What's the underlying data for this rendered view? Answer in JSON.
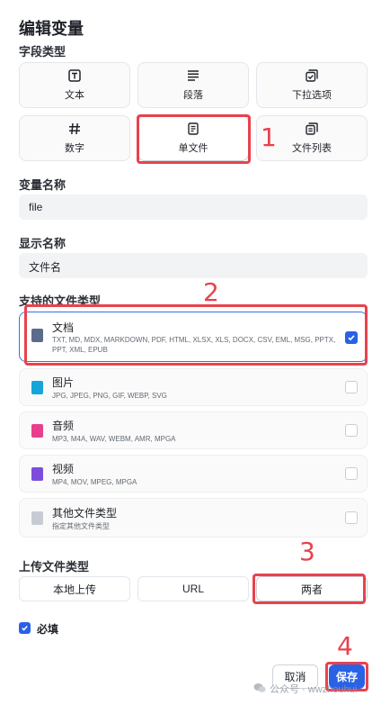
{
  "dialog": {
    "title": "编辑变量",
    "field_type_label": "字段类型",
    "field_types": [
      {
        "label": "文本",
        "icon": "text-icon"
      },
      {
        "label": "段落",
        "icon": "paragraph-icon"
      },
      {
        "label": "下拉选项",
        "icon": "select-icon"
      },
      {
        "label": "数字",
        "icon": "number-icon"
      },
      {
        "label": "单文件",
        "icon": "single-file-icon",
        "selected": true
      },
      {
        "label": "文件列表",
        "icon": "file-list-icon"
      }
    ],
    "variable_name_label": "变量名称",
    "variable_name_value": "file",
    "display_name_label": "显示名称",
    "display_name_value": "文件名",
    "supported_types_label": "支持的文件类型",
    "file_types": [
      {
        "title": "文档",
        "desc": "TXT, MD, MDX, MARKDOWN, PDF, HTML, XLSX, XLS, DOCX, CSV, EML, MSG, PPTX, PPT, XML, EPUB",
        "checked": true,
        "color": "#5b6b8c"
      },
      {
        "title": "图片",
        "desc": "JPG, JPEG, PNG, GIF, WEBP, SVG",
        "checked": false,
        "color": "#16a5d8"
      },
      {
        "title": "音频",
        "desc": "MP3, M4A, WAV, WEBM, AMR, MPGA",
        "checked": false,
        "color": "#e83e8c"
      },
      {
        "title": "视频",
        "desc": "MP4, MOV, MPEG, MPGA",
        "checked": false,
        "color": "#7c4ddc"
      },
      {
        "title": "其他文件类型",
        "desc": "指定其他文件类型",
        "checked": false,
        "color": "#c7cbd4"
      }
    ],
    "upload_type_label": "上传文件类型",
    "upload_types": [
      "本地上传",
      "URL",
      "两者"
    ],
    "required_label": "必填",
    "cancel_label": "取消",
    "save_label": "保存"
  },
  "annotations": [
    "1",
    "2",
    "3",
    "4"
  ],
  "watermark": {
    "brand": "公众号 · wwzhouhui"
  },
  "colors": {
    "accent": "#2a62e6",
    "annotation": "#e8424e"
  }
}
